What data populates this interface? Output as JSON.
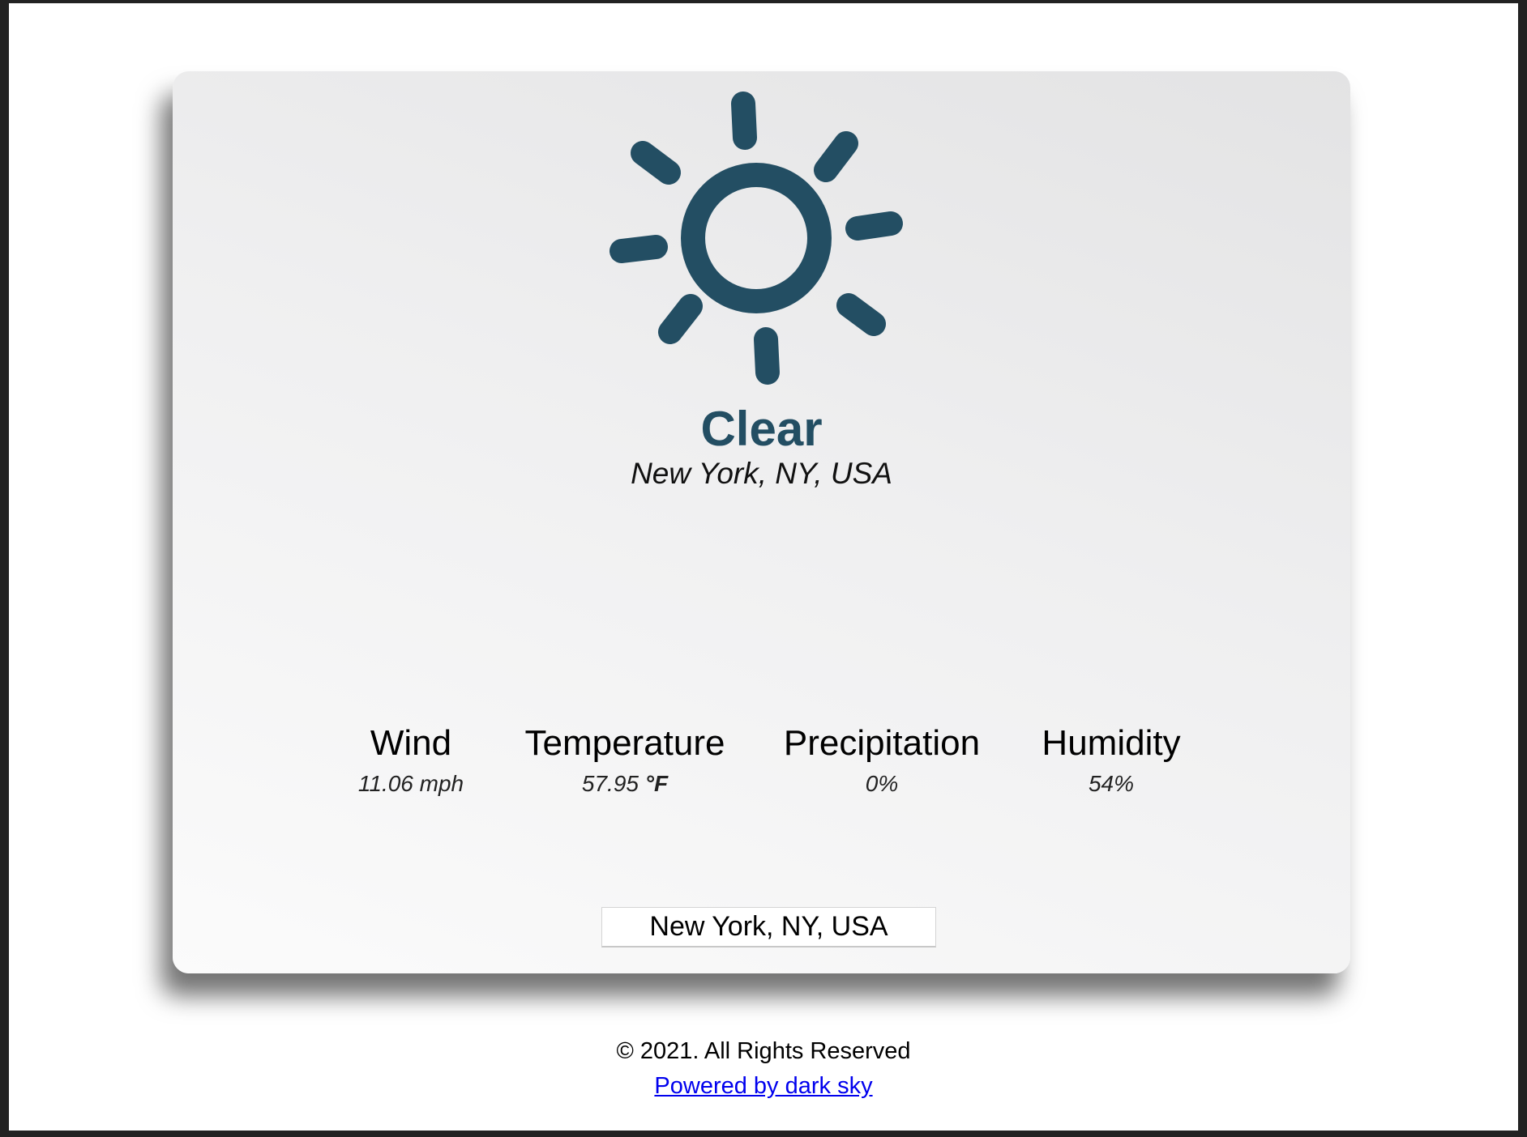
{
  "weather": {
    "summary": "Clear",
    "location": "New York, NY, USA",
    "icon": "sun-icon",
    "accent_color": "#234e63"
  },
  "stats": [
    {
      "label": "Wind",
      "value": "11.06 mph",
      "unit": ""
    },
    {
      "label": "Temperature",
      "value": "57.95 ",
      "unit": "°F"
    },
    {
      "label": "Precipitation",
      "value": "0%",
      "unit": ""
    },
    {
      "label": "Humidity",
      "value": "54%",
      "unit": ""
    }
  ],
  "search": {
    "value": "New York, NY, USA"
  },
  "footer": {
    "copyright": "© 2021. All Rights Reserved",
    "powered_by": "Powered by dark sky",
    "link_color": "#0000ee"
  }
}
